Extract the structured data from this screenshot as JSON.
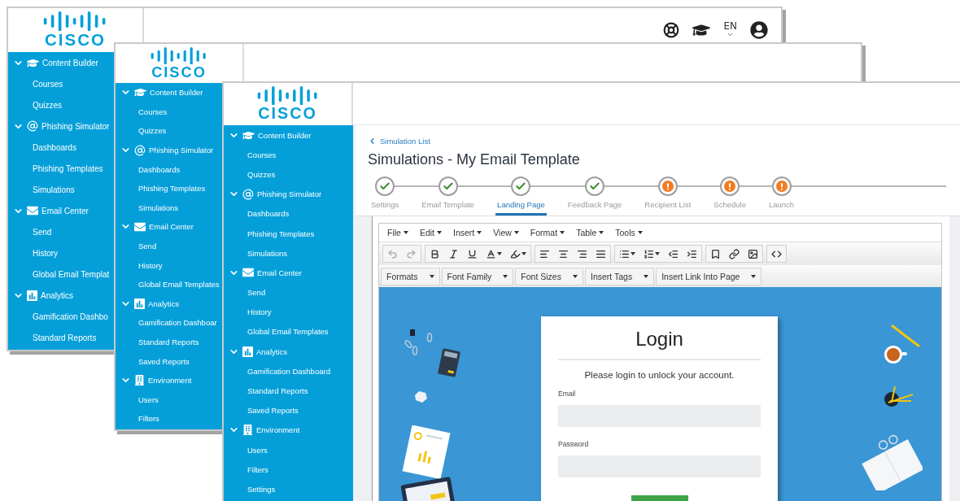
{
  "windows": [
    {
      "logo": "CISCO",
      "top_bar": {
        "language": "EN"
      },
      "sidebar": [
        {
          "label": "Content Builder",
          "expanded": true,
          "children": [
            {
              "label": "Courses"
            },
            {
              "label": "Quizzes"
            }
          ]
        },
        {
          "label": "Phishing Simulator",
          "expanded": true,
          "children": [
            {
              "label": "Dashboards"
            },
            {
              "label": "Phishing Templates"
            },
            {
              "label": "Simulations"
            }
          ]
        },
        {
          "label": "Email Center",
          "expanded": true,
          "children": [
            {
              "label": "Send"
            },
            {
              "label": "History"
            },
            {
              "label": "Global Email Templat"
            }
          ]
        },
        {
          "label": "Analytics",
          "expanded": true,
          "children": [
            {
              "label": "Gamification Dashbo"
            },
            {
              "label": "Standard Reports"
            }
          ]
        }
      ]
    },
    {
      "logo": "CISCO",
      "sidebar": [
        {
          "label": "Content Builder",
          "expanded": true,
          "children": [
            {
              "label": "Courses"
            },
            {
              "label": "Quizzes"
            }
          ]
        },
        {
          "label": "Phishing Simulator",
          "expanded": true,
          "children": [
            {
              "label": "Dashboards"
            },
            {
              "label": "Phishing Templates"
            },
            {
              "label": "Simulations"
            }
          ]
        },
        {
          "label": "Email Center",
          "expanded": true,
          "children": [
            {
              "label": "Send"
            },
            {
              "label": "History"
            },
            {
              "label": "Global Email Templates"
            }
          ]
        },
        {
          "label": "Analytics",
          "expanded": true,
          "children": [
            {
              "label": "Gamification Dashboar"
            },
            {
              "label": "Standard Reports"
            },
            {
              "label": "Saved Reports"
            }
          ]
        },
        {
          "label": "Environment",
          "expanded": true,
          "children": [
            {
              "label": "Users"
            },
            {
              "label": "Filters"
            }
          ]
        }
      ]
    },
    {
      "logo": "CISCO",
      "sidebar": [
        {
          "label": "Content Builder",
          "expanded": true,
          "children": [
            {
              "label": "Courses"
            },
            {
              "label": "Quizzes"
            }
          ]
        },
        {
          "label": "Phishing Simulator",
          "expanded": true,
          "children": [
            {
              "label": "Dashboards"
            },
            {
              "label": "Phishing Templates"
            },
            {
              "label": "Simulations"
            }
          ]
        },
        {
          "label": "Email Center",
          "expanded": true,
          "children": [
            {
              "label": "Send"
            },
            {
              "label": "History"
            },
            {
              "label": "Global Email Templates"
            }
          ]
        },
        {
          "label": "Analytics",
          "expanded": true,
          "children": [
            {
              "label": "Gamification Dashboard"
            },
            {
              "label": "Standard Reports"
            },
            {
              "label": "Saved Reports"
            }
          ]
        },
        {
          "label": "Environment",
          "expanded": true,
          "children": [
            {
              "label": "Users"
            },
            {
              "label": "Filters"
            },
            {
              "label": "Settings"
            }
          ]
        }
      ],
      "content": {
        "breadcrumb": "Simulation List",
        "title": "Simulations - My Email Template",
        "steps": [
          {
            "label": "Settings",
            "complete": true,
            "selected": false
          },
          {
            "label": "Email Template",
            "complete": true,
            "selected": false
          },
          {
            "label": "Landing Page",
            "complete": true,
            "selected": true
          },
          {
            "label": "Feedback Page",
            "complete": true,
            "selected": false
          },
          {
            "label": "Recipient List",
            "complete": false,
            "selected": false
          },
          {
            "label": "Schedule",
            "complete": false,
            "selected": false
          },
          {
            "label": "Launch",
            "complete": false,
            "selected": false
          }
        ],
        "menubar": [
          "File",
          "Edit",
          "Insert",
          "View",
          "Format",
          "Table",
          "Tools"
        ],
        "toolbar": [
          [
            {
              "kind": "undo",
              "disabled": true,
              "dropdown": false
            },
            {
              "kind": "redo",
              "disabled": true,
              "dropdown": false
            }
          ],
          [
            {
              "kind": "bold",
              "disabled": false,
              "dropdown": false
            },
            {
              "kind": "italic",
              "disabled": false,
              "dropdown": false
            },
            {
              "kind": "underline",
              "disabled": false,
              "dropdown": false
            },
            {
              "kind": "text-color",
              "disabled": false,
              "dropdown": true
            },
            {
              "kind": "highlight",
              "disabled": false,
              "dropdown": true
            }
          ],
          [
            {
              "kind": "align-left",
              "disabled": false,
              "dropdown": false
            },
            {
              "kind": "align-center",
              "disabled": false,
              "dropdown": false
            },
            {
              "kind": "align-right",
              "disabled": false,
              "dropdown": false
            },
            {
              "kind": "align-justify",
              "disabled": false,
              "dropdown": false
            }
          ],
          [
            {
              "kind": "bullet-list",
              "disabled": false,
              "dropdown": true
            },
            {
              "kind": "numbered-list",
              "disabled": false,
              "dropdown": true
            },
            {
              "kind": "outdent",
              "disabled": false,
              "dropdown": false
            },
            {
              "kind": "indent",
              "disabled": false,
              "dropdown": false
            }
          ],
          [
            {
              "kind": "bookmark",
              "disabled": false,
              "dropdown": false
            },
            {
              "kind": "link",
              "disabled": false,
              "dropdown": false
            },
            {
              "kind": "image",
              "disabled": false,
              "dropdown": false
            }
          ],
          [
            {
              "kind": "code",
              "disabled": false,
              "dropdown": false
            }
          ]
        ],
        "format_bar": [
          "Formats",
          "Font Family",
          "Font Sizes",
          "Insert Tags",
          "Insert Link Into Page"
        ],
        "login": {
          "title": "Login",
          "message": "Please login to unlock your account.",
          "fields": [
            {
              "label": "Email"
            },
            {
              "label": "Password"
            }
          ]
        }
      }
    }
  ]
}
